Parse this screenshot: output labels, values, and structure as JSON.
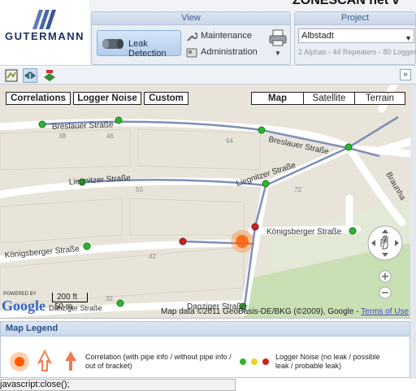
{
  "app": {
    "title": "ZONESCAN net v",
    "brand": "GUTERMANN"
  },
  "view_group": {
    "header": "View",
    "leak_detection_label": "Leak Detection",
    "maintenance_label": "Maintenance",
    "administration_label": "Administration"
  },
  "project_group": {
    "header": "Project",
    "selected": "Albstadt",
    "info": "2 Alphas - 44 Repeaters - 80 Loggers"
  },
  "map": {
    "tabs": [
      "Correlations",
      "Logger Noise",
      "Custom"
    ],
    "types": [
      "Map",
      "Satellite",
      "Terrain"
    ],
    "streets": [
      "Breslauer Straße",
      "Breslauer Straße",
      "Liegnitzer Straße",
      "Liegnitzer Straße",
      "Königsberger Straße",
      "Königsberger Straße",
      "Danziger Straße",
      "Danziger Straße",
      "Braunha"
    ],
    "house_numbers": [
      "38",
      "46",
      "64",
      "50",
      "72",
      "42",
      "32"
    ],
    "attribution": "Map data ©2011 GeoBasis-DE/BKG (©2009), Google - ",
    "terms_link": "Terms of Use",
    "scale_ft": "200 ft",
    "scale_m": "50 m",
    "powered_by": "POWERED BY",
    "google": "Google"
  },
  "legend": {
    "title": "Map Legend",
    "correlation_text": "Correlation (with pipe info / without pipe info / out of bracket)",
    "noise_text": "Logger Noise (no leak / possible leak / probable leak)"
  },
  "status": {
    "text": "javascript:close();"
  },
  "colors": {
    "accent": "#3a5a8a",
    "logger_no_leak": "#2db52d",
    "logger_possible": "#e8d21c",
    "logger_probable": "#cc2222",
    "leak_glow": "#ff6a00"
  }
}
